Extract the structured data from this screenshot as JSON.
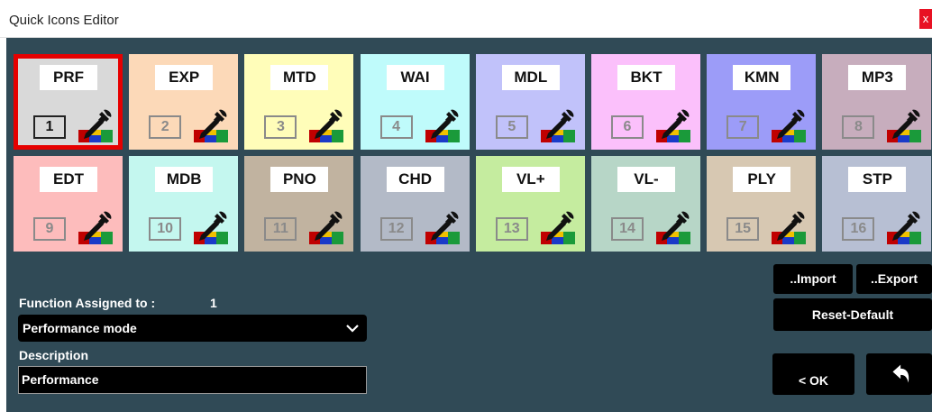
{
  "window": {
    "title": "Quick Icons Editor",
    "close_glyph": "x"
  },
  "tiles": [
    {
      "code": "PRF",
      "number": "1",
      "color": "#d9d9d9"
    },
    {
      "code": "EXP",
      "number": "2",
      "color": "#fcd9b8"
    },
    {
      "code": "MTD",
      "number": "3",
      "color": "#fffdb9"
    },
    {
      "code": "WAI",
      "number": "4",
      "color": "#bffbfb"
    },
    {
      "code": "MDL",
      "number": "5",
      "color": "#c1c2fa"
    },
    {
      "code": "BKT",
      "number": "6",
      "color": "#fbc0fb"
    },
    {
      "code": "KMN",
      "number": "7",
      "color": "#9c9cf8"
    },
    {
      "code": "MP3",
      "number": "8",
      "color": "#c7adbd"
    },
    {
      "code": "EDT",
      "number": "9",
      "color": "#fdbcbc"
    },
    {
      "code": "MDB",
      "number": "10",
      "color": "#c4f7ef"
    },
    {
      "code": "PNO",
      "number": "11",
      "color": "#c1b3a0"
    },
    {
      "code": "CHD",
      "number": "12",
      "color": "#b3bac7"
    },
    {
      "code": "VL+",
      "number": "13",
      "color": "#c5ec9f"
    },
    {
      "code": "VL-",
      "number": "14",
      "color": "#b7d6c7"
    },
    {
      "code": "PLY",
      "number": "15",
      "color": "#d7c8b2"
    },
    {
      "code": "STP",
      "number": "16",
      "color": "#b7bfd3"
    }
  ],
  "selected_tile": "1",
  "function": {
    "label": "Function Assigned to :",
    "assigned_number": "1",
    "selected_value": "Performance mode"
  },
  "description": {
    "label": "Description",
    "value": "Performance"
  },
  "buttons": {
    "import": "..Import",
    "export": "..Export",
    "reset": "Reset-Default",
    "ok": "< OK"
  },
  "icons": {
    "picker": "eyedropper-color-icon",
    "chevron": "chevron-down-icon",
    "back": "return-arrow-icon"
  }
}
